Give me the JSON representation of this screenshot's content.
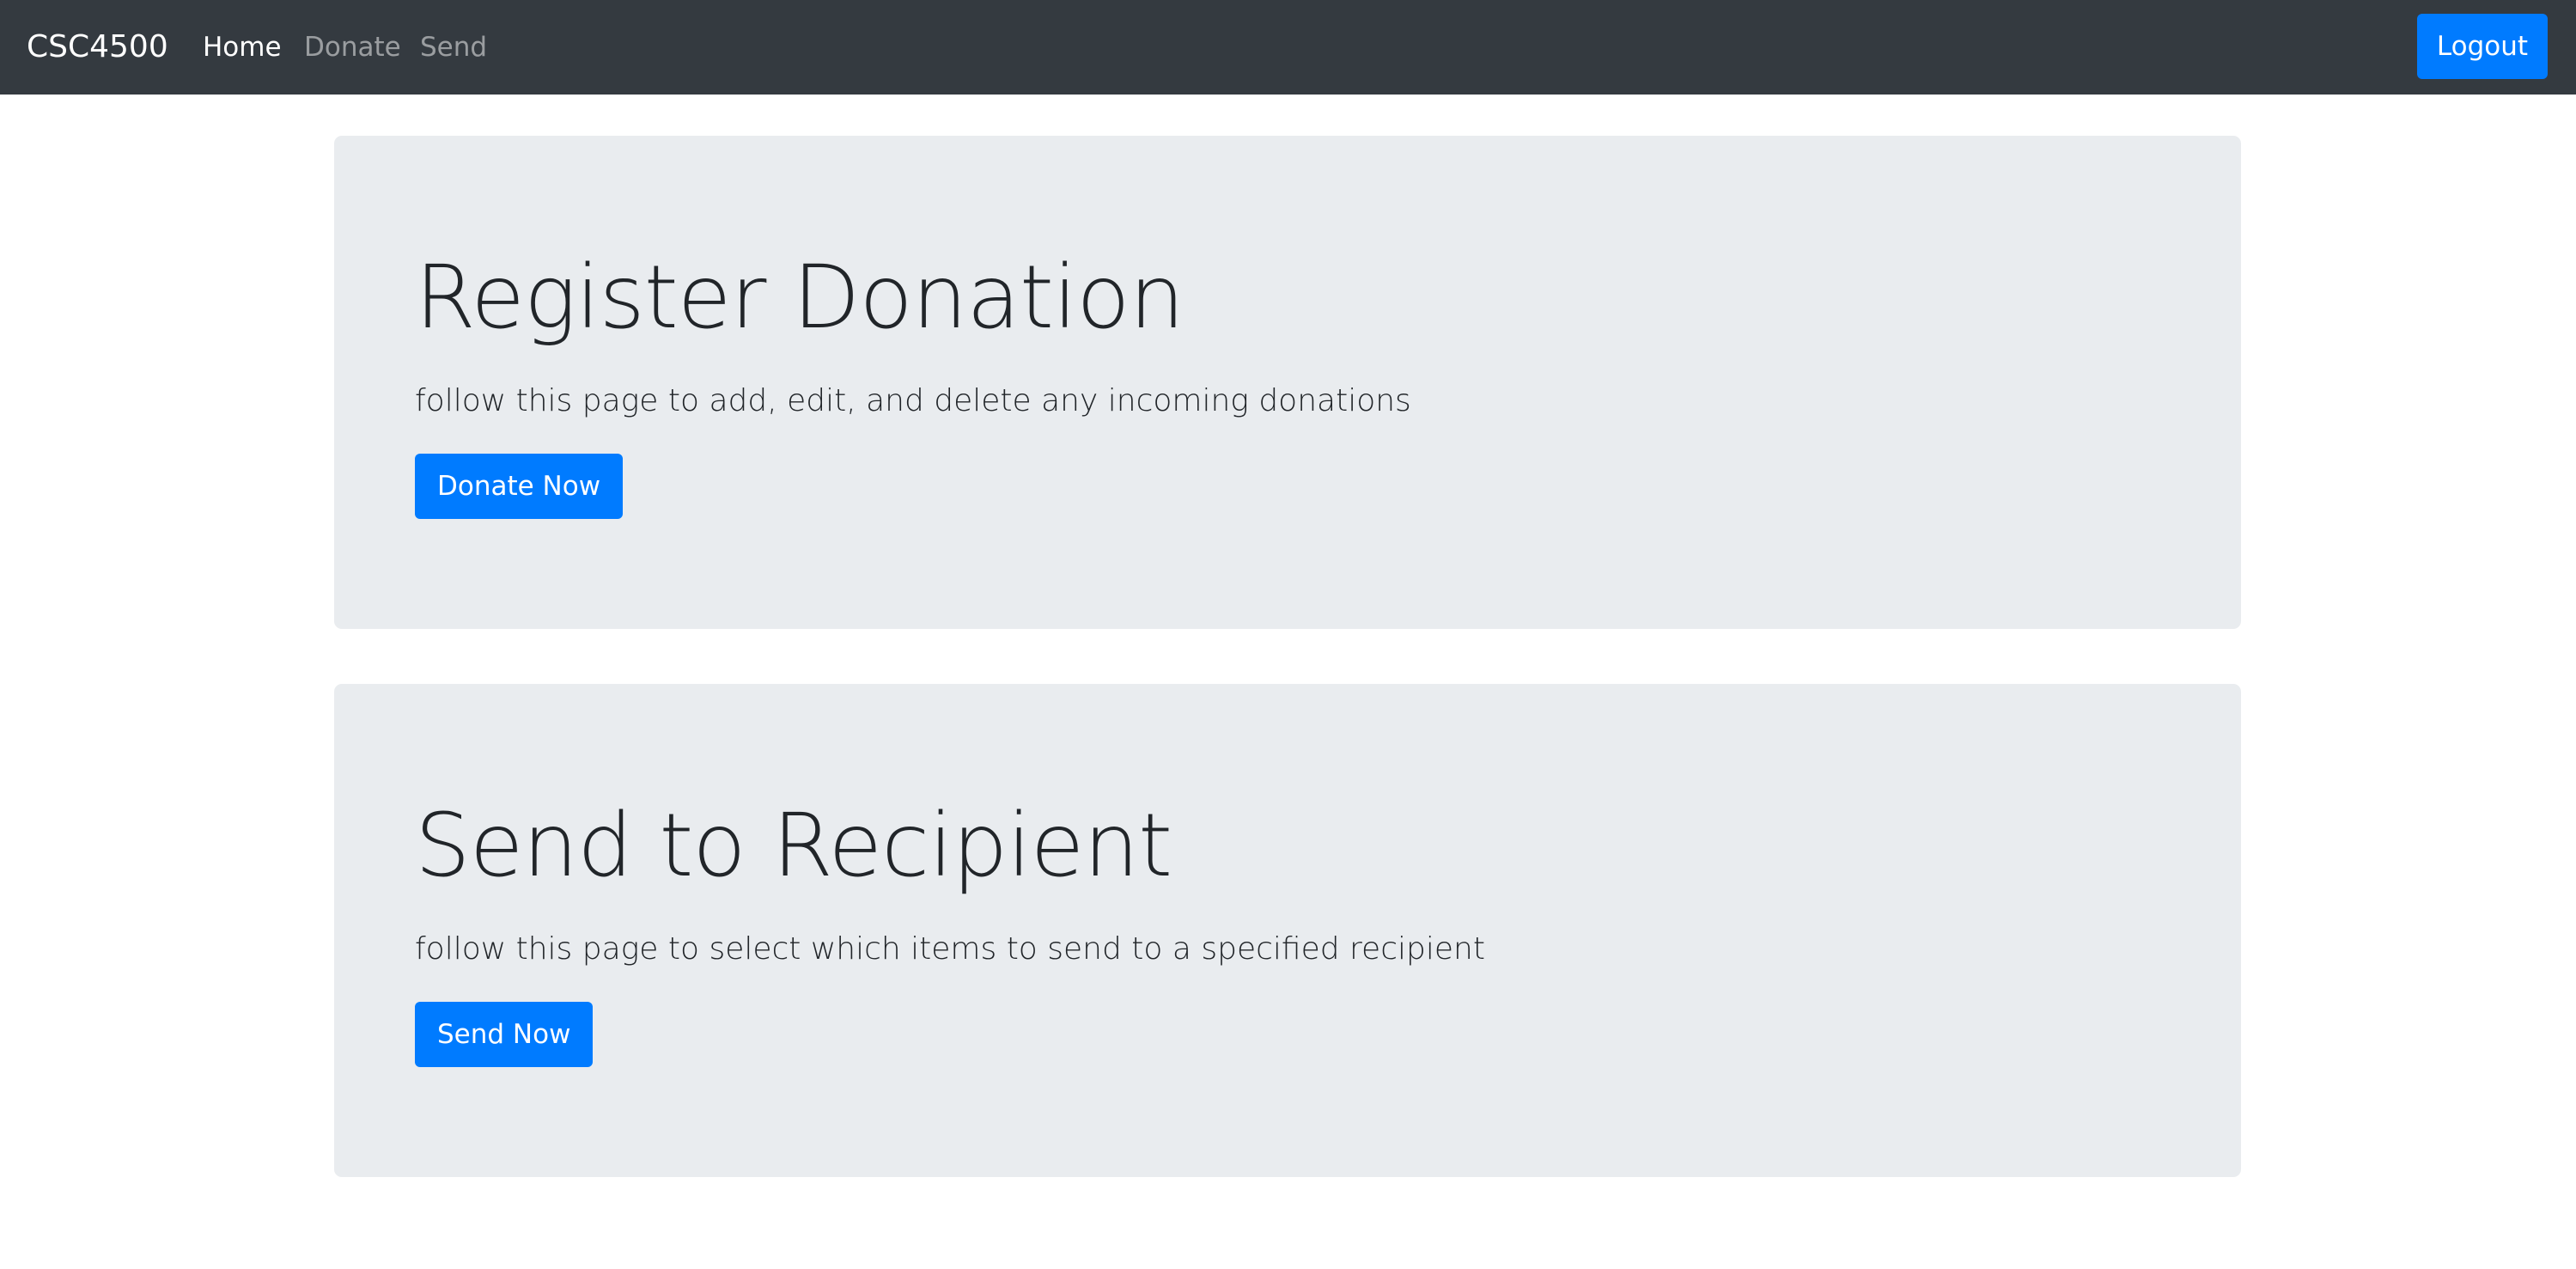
{
  "navbar": {
    "brand": "CSC4500",
    "links": [
      {
        "label": "Home",
        "active": true
      },
      {
        "label": "Donate",
        "active": false
      },
      {
        "label": "Send",
        "active": false
      }
    ],
    "logout_label": "Logout"
  },
  "sections": [
    {
      "title": "Register Donation",
      "lead": "follow this page to add, edit, and delete any incoming donations",
      "button_label": "Donate Now"
    },
    {
      "title": "Send to Recipient",
      "lead": "follow this page to select which items to send to a specified recipient",
      "button_label": "Send Now"
    }
  ],
  "colors": {
    "navbar_bg": "#343a40",
    "primary": "#007bff",
    "jumbotron_bg": "#e9ecef",
    "text": "#212529"
  }
}
